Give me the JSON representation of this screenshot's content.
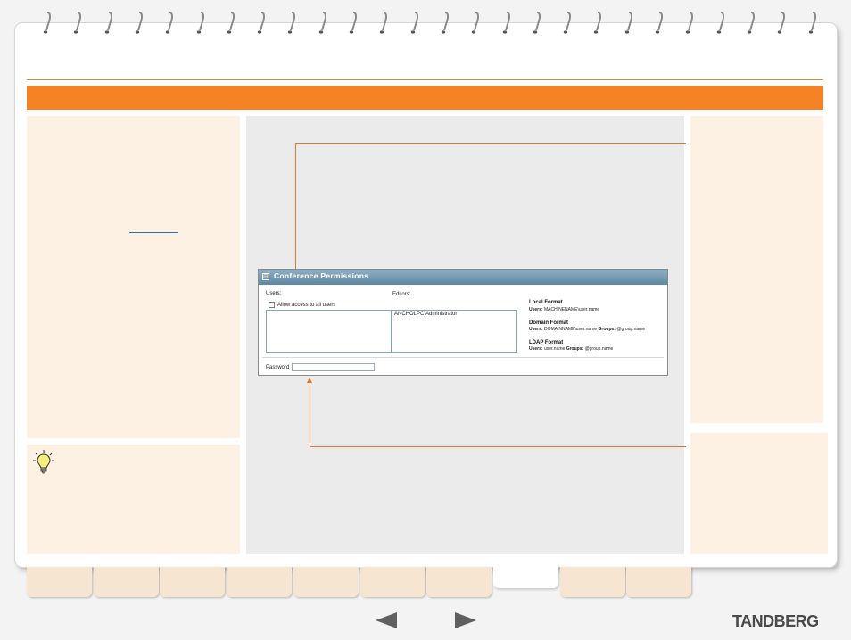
{
  "colors": {
    "accent": "#f58225",
    "panel": "#fdf1e4",
    "center_panel": "#ebebeb",
    "tab": "#f6e5d1",
    "window_title": "#5c86a2",
    "link": "#2a6fc9"
  },
  "icons": {
    "rings": "spiral-binding-ring-icon",
    "tip": "lightbulb-icon",
    "prev": "previous-arrow-icon",
    "next": "next-arrow-icon"
  },
  "conference_permissions": {
    "title": "Conference Permissions",
    "toggle_symbol": "⊟",
    "users_label": "Users:",
    "editors_label": "Editors:",
    "allow_all_label": "Allow access to all users",
    "allow_all_checked": false,
    "users_list": [],
    "editors_list": [
      "ANCHOLPC\\Administrator"
    ],
    "formats": {
      "local": {
        "title": "Local Format",
        "users_label": "Users:",
        "users_value": "MACHINENAME\\user.name"
      },
      "domain": {
        "title": "Domain Format",
        "users_label": "Users:",
        "users_value": "DOMAINNAME\\user.name",
        "groups_label": "Groups:",
        "groups_value": "@group.name"
      },
      "ldap": {
        "title": "LDAP Format",
        "users_label": "Users:",
        "users_value": "user.name",
        "groups_label": "Groups:",
        "groups_value": "@group.name"
      }
    },
    "password_label": "Password",
    "password_value": ""
  },
  "tabs": {
    "count": 10,
    "active_index": 7
  },
  "brand": "TANDBERG"
}
